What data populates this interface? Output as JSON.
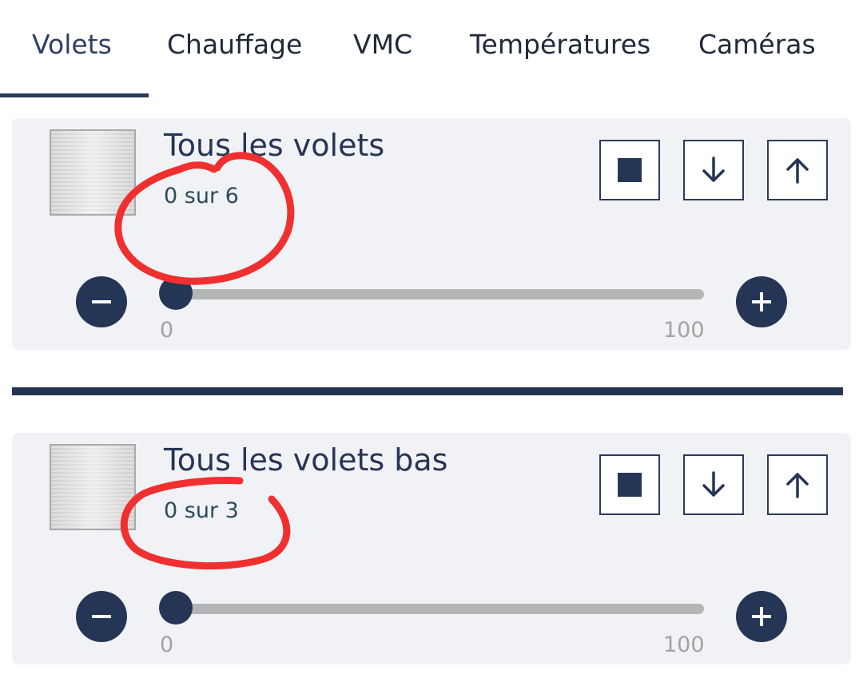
{
  "tabs": [
    {
      "label": "Volets",
      "active": true
    },
    {
      "label": "Chauffage",
      "active": false
    },
    {
      "label": "VMC",
      "active": false
    },
    {
      "label": "Températures",
      "active": false
    },
    {
      "label": "Caméras",
      "active": false
    }
  ],
  "groups": [
    {
      "title": "Tous les volets",
      "status": "0 sur 6",
      "slider": {
        "value": 0,
        "min_label": "0",
        "max_label": "100"
      },
      "controls": {
        "stop": "stop-icon",
        "down": "arrow-down-icon",
        "up": "arrow-up-icon"
      }
    },
    {
      "title": "Tous les volets bas",
      "status": "0 sur 3",
      "slider": {
        "value": 0,
        "min_label": "0",
        "max_label": "100"
      },
      "controls": {
        "stop": "stop-icon",
        "down": "arrow-down-icon",
        "up": "arrow-up-icon"
      }
    }
  ],
  "colors": {
    "primary": "#243556",
    "card_background": "#f0f2f5",
    "slider_track": "#b5b5b5",
    "annotation": "#f03030"
  }
}
